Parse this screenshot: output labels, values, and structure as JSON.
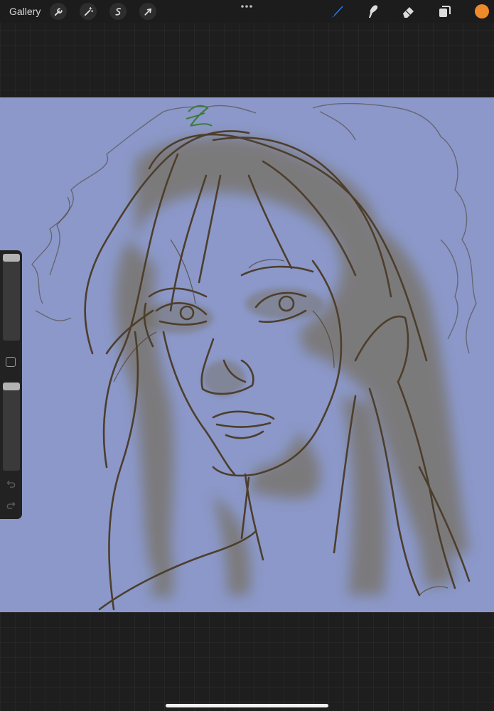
{
  "topbar": {
    "gallery_label": "Gallery",
    "left_tools": [
      {
        "icon": "wrench-icon",
        "name": "actions-button"
      },
      {
        "icon": "magic-wand-icon",
        "name": "adjustments-button"
      },
      {
        "icon": "selection-s-icon",
        "name": "selection-button"
      },
      {
        "icon": "arrow-cursor-icon",
        "name": "transform-button"
      }
    ],
    "right_tools": [
      {
        "icon": "brush-icon",
        "name": "brush-tool-button",
        "active": true
      },
      {
        "icon": "smudge-icon",
        "name": "smudge-tool-button",
        "active": false
      },
      {
        "icon": "eraser-icon",
        "name": "eraser-tool-button",
        "active": false
      },
      {
        "icon": "layers-icon",
        "name": "layers-button",
        "active": false
      }
    ],
    "active_color": "#ef8a2a"
  },
  "sidebar": {
    "brush_size": 0.0,
    "opacity": 0.0,
    "undo_enabled": false,
    "redo_enabled": false
  },
  "canvas": {
    "background_color": "#8b98c9",
    "line_color": "#4d3e2c",
    "shading_color": "#6e623e"
  },
  "colors": {
    "accent_blue": "#2f7cf6",
    "app_background": "#1e1e1e"
  }
}
